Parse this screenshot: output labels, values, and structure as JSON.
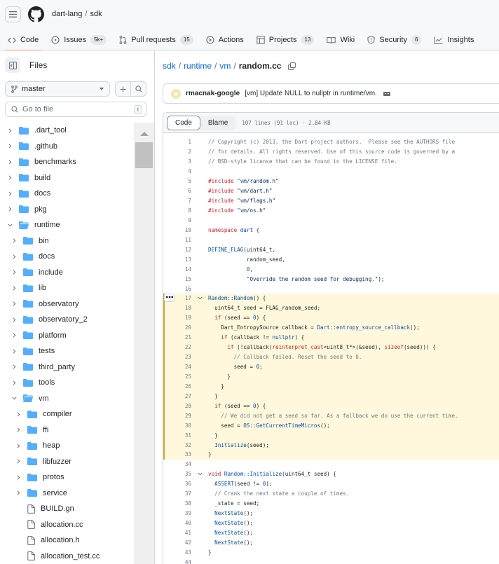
{
  "header": {
    "owner": "dart-lang",
    "repo": "sdk",
    "nav": [
      {
        "label": "Code",
        "icon": "code-icon",
        "active": true
      },
      {
        "label": "Issues",
        "icon": "issue-icon",
        "counter": "5k+"
      },
      {
        "label": "Pull requests",
        "icon": "pull-request-icon",
        "counter": "15"
      },
      {
        "label": "Actions",
        "icon": "play-icon"
      },
      {
        "label": "Projects",
        "icon": "table-icon",
        "counter": "13"
      },
      {
        "label": "Wiki",
        "icon": "book-icon"
      },
      {
        "label": "Security",
        "icon": "shield-icon",
        "counter": "6"
      },
      {
        "label": "Insights",
        "icon": "graph-icon"
      }
    ]
  },
  "sidebar": {
    "title": "Files",
    "branch": "master",
    "search_placeholder": "Go to file",
    "search_shortcut": "t",
    "tree": [
      {
        "name": ".dart_tool",
        "type": "folder",
        "depth": 0,
        "expanded": false
      },
      {
        "name": ".github",
        "type": "folder",
        "depth": 0,
        "expanded": false
      },
      {
        "name": "benchmarks",
        "type": "folder",
        "depth": 0,
        "expanded": false
      },
      {
        "name": "build",
        "type": "folder",
        "depth": 0,
        "expanded": false
      },
      {
        "name": "docs",
        "type": "folder",
        "depth": 0,
        "expanded": false
      },
      {
        "name": "pkg",
        "type": "folder",
        "depth": 0,
        "expanded": false
      },
      {
        "name": "runtime",
        "type": "folder",
        "depth": 0,
        "expanded": true
      },
      {
        "name": "bin",
        "type": "folder",
        "depth": 1,
        "expanded": false
      },
      {
        "name": "docs",
        "type": "folder",
        "depth": 1,
        "expanded": false
      },
      {
        "name": "include",
        "type": "folder",
        "depth": 1,
        "expanded": false
      },
      {
        "name": "lib",
        "type": "folder",
        "depth": 1,
        "expanded": false
      },
      {
        "name": "observatory",
        "type": "folder",
        "depth": 1,
        "expanded": false
      },
      {
        "name": "observatory_2",
        "type": "folder",
        "depth": 1,
        "expanded": false
      },
      {
        "name": "platform",
        "type": "folder",
        "depth": 1,
        "expanded": false
      },
      {
        "name": "tests",
        "type": "folder",
        "depth": 1,
        "expanded": false
      },
      {
        "name": "third_party",
        "type": "folder",
        "depth": 1,
        "expanded": false
      },
      {
        "name": "tools",
        "type": "folder",
        "depth": 1,
        "expanded": false
      },
      {
        "name": "vm",
        "type": "folder",
        "depth": 1,
        "expanded": true
      },
      {
        "name": "compiler",
        "type": "folder",
        "depth": 2,
        "expanded": false
      },
      {
        "name": "ffi",
        "type": "folder",
        "depth": 2,
        "expanded": false
      },
      {
        "name": "heap",
        "type": "folder",
        "depth": 2,
        "expanded": false
      },
      {
        "name": "libfuzzer",
        "type": "folder",
        "depth": 2,
        "expanded": false
      },
      {
        "name": "protos",
        "type": "folder",
        "depth": 2,
        "expanded": false
      },
      {
        "name": "service",
        "type": "folder",
        "depth": 2,
        "expanded": false
      },
      {
        "name": "BUILD.gn",
        "type": "file",
        "depth": 2
      },
      {
        "name": "allocation.cc",
        "type": "file",
        "depth": 2
      },
      {
        "name": "allocation.h",
        "type": "file",
        "depth": 2
      },
      {
        "name": "allocation_test.cc",
        "type": "file",
        "depth": 2
      }
    ]
  },
  "main": {
    "breadcrumb": [
      "sdk",
      "runtime",
      "vm"
    ],
    "filename": "random.cc",
    "commit": {
      "author": "rmacnak-google",
      "message": "[vm] Update NULL to nullptr in runtime/vm."
    },
    "tabs": {
      "code": "Code",
      "blame": "Blame"
    },
    "file_meta": "107 lines (91 loc) · 2.84 KB",
    "highlight_range": [
      17,
      33
    ],
    "code": [
      {
        "n": 1,
        "t": [
          [
            "com",
            "// Copyright (c) 2013, the Dart project authors.  Please see the AUTHORS file"
          ]
        ]
      },
      {
        "n": 2,
        "t": [
          [
            "com",
            "// for details. All rights reserved. Use of this source code is governed by a"
          ]
        ]
      },
      {
        "n": 3,
        "t": [
          [
            "com",
            "// BSD-style license that can be found in the LICENSE file."
          ]
        ]
      },
      {
        "n": 4,
        "t": []
      },
      {
        "n": 5,
        "t": [
          [
            "kw",
            "#include"
          ],
          [
            "pl",
            " "
          ],
          [
            "str",
            "\"vm/random.h\""
          ]
        ]
      },
      {
        "n": 6,
        "t": [
          [
            "kw",
            "#include"
          ],
          [
            "pl",
            " "
          ],
          [
            "str",
            "\"vm/dart.h\""
          ]
        ]
      },
      {
        "n": 7,
        "t": [
          [
            "kw",
            "#include"
          ],
          [
            "pl",
            " "
          ],
          [
            "str",
            "\"vm/flags.h\""
          ]
        ]
      },
      {
        "n": 8,
        "t": [
          [
            "kw",
            "#include"
          ],
          [
            "pl",
            " "
          ],
          [
            "str",
            "\"vm/os.h\""
          ]
        ]
      },
      {
        "n": 9,
        "t": []
      },
      {
        "n": 10,
        "t": [
          [
            "kw",
            "namespace"
          ],
          [
            "pl",
            " "
          ],
          [
            "ent",
            "dart"
          ],
          [
            "pl",
            " {"
          ]
        ]
      },
      {
        "n": 11,
        "t": []
      },
      {
        "n": 12,
        "t": [
          [
            "ent",
            "DEFINE_FLAG"
          ],
          [
            "pl",
            "(uint64_t,"
          ]
        ]
      },
      {
        "n": 13,
        "t": [
          [
            "pl",
            "            random_seed,"
          ]
        ]
      },
      {
        "n": 14,
        "t": [
          [
            "pl",
            "            "
          ],
          [
            "ent",
            "0"
          ],
          [
            "pl",
            ","
          ]
        ]
      },
      {
        "n": 15,
        "t": [
          [
            "pl",
            "            "
          ],
          [
            "str",
            "\"Override the random seed for debugging.\""
          ],
          [
            "pl",
            ");"
          ]
        ]
      },
      {
        "n": 16,
        "t": []
      },
      {
        "n": 17,
        "fold": true,
        "more": true,
        "t": [
          [
            "ent",
            "Random::Random"
          ],
          [
            "pl",
            "() {"
          ]
        ]
      },
      {
        "n": 18,
        "t": [
          [
            "pl",
            "  uint64_t seed = FLAG_random_seed;"
          ]
        ]
      },
      {
        "n": 19,
        "t": [
          [
            "pl",
            "  "
          ],
          [
            "kw",
            "if"
          ],
          [
            "pl",
            " (seed == "
          ],
          [
            "ent",
            "0"
          ],
          [
            "pl",
            ") {"
          ]
        ]
      },
      {
        "n": 20,
        "t": [
          [
            "pl",
            "    Dart_EntropySource callback = "
          ],
          [
            "ent",
            "Dart::entropy_source_callback"
          ],
          [
            "pl",
            "();"
          ]
        ]
      },
      {
        "n": 21,
        "t": [
          [
            "pl",
            "    "
          ],
          [
            "kw",
            "if"
          ],
          [
            "pl",
            " (callback != "
          ],
          [
            "ent",
            "nullptr"
          ],
          [
            "pl",
            ") {"
          ]
        ]
      },
      {
        "n": 22,
        "t": [
          [
            "pl",
            "      "
          ],
          [
            "kw",
            "if"
          ],
          [
            "pl",
            " (!callback("
          ],
          [
            "kw",
            "reinterpret_cast"
          ],
          [
            "pl",
            "<uint8_t*>(&seed), "
          ],
          [
            "kw",
            "sizeof"
          ],
          [
            "pl",
            "(seed))) {"
          ]
        ]
      },
      {
        "n": 23,
        "t": [
          [
            "pl",
            "        "
          ],
          [
            "com",
            "// Callback failed. Reset the seed to 0."
          ]
        ]
      },
      {
        "n": 24,
        "t": [
          [
            "pl",
            "        seed = "
          ],
          [
            "ent",
            "0"
          ],
          [
            "pl",
            ";"
          ]
        ]
      },
      {
        "n": 25,
        "t": [
          [
            "pl",
            "      }"
          ]
        ]
      },
      {
        "n": 26,
        "t": [
          [
            "pl",
            "    }"
          ]
        ]
      },
      {
        "n": 27,
        "t": [
          [
            "pl",
            "  }"
          ]
        ]
      },
      {
        "n": 28,
        "t": [
          [
            "pl",
            "  "
          ],
          [
            "kw",
            "if"
          ],
          [
            "pl",
            " (seed == "
          ],
          [
            "ent",
            "0"
          ],
          [
            "pl",
            ") {"
          ]
        ]
      },
      {
        "n": 29,
        "t": [
          [
            "pl",
            "    "
          ],
          [
            "com",
            "// We did not get a seed so far. As a fallback we do use the current time."
          ]
        ]
      },
      {
        "n": 30,
        "t": [
          [
            "pl",
            "    seed = "
          ],
          [
            "ent",
            "OS::GetCurrentTimeMicros"
          ],
          [
            "pl",
            "();"
          ]
        ]
      },
      {
        "n": 31,
        "t": [
          [
            "pl",
            "  }"
          ]
        ]
      },
      {
        "n": 32,
        "t": [
          [
            "pl",
            "  "
          ],
          [
            "ent",
            "Initialize"
          ],
          [
            "pl",
            "(seed);"
          ]
        ]
      },
      {
        "n": 33,
        "t": [
          [
            "pl",
            "}"
          ]
        ]
      },
      {
        "n": 34,
        "t": []
      },
      {
        "n": 35,
        "fold": true,
        "t": [
          [
            "kw",
            "void"
          ],
          [
            "pl",
            " "
          ],
          [
            "ent",
            "Random::Initialize"
          ],
          [
            "pl",
            "(uint64_t seed) {"
          ]
        ]
      },
      {
        "n": 36,
        "t": [
          [
            "pl",
            "  "
          ],
          [
            "ent",
            "ASSERT"
          ],
          [
            "pl",
            "(seed != "
          ],
          [
            "ent",
            "0"
          ],
          [
            "pl",
            ");"
          ]
        ]
      },
      {
        "n": 37,
        "t": [
          [
            "pl",
            "  "
          ],
          [
            "com",
            "// Crank the next state a couple of times."
          ]
        ]
      },
      {
        "n": 38,
        "t": [
          [
            "pl",
            "  _state = seed;"
          ]
        ]
      },
      {
        "n": 39,
        "t": [
          [
            "pl",
            "  "
          ],
          [
            "ent",
            "NextState"
          ],
          [
            "pl",
            "();"
          ]
        ]
      },
      {
        "n": 40,
        "t": [
          [
            "pl",
            "  "
          ],
          [
            "ent",
            "NextState"
          ],
          [
            "pl",
            "();"
          ]
        ]
      },
      {
        "n": 41,
        "t": [
          [
            "pl",
            "  "
          ],
          [
            "ent",
            "NextState"
          ],
          [
            "pl",
            "();"
          ]
        ]
      },
      {
        "n": 42,
        "t": [
          [
            "pl",
            "  "
          ],
          [
            "ent",
            "NextState"
          ],
          [
            "pl",
            "();"
          ]
        ]
      },
      {
        "n": 43,
        "t": [
          [
            "pl",
            "}"
          ]
        ]
      },
      {
        "n": 44,
        "t": []
      }
    ]
  }
}
